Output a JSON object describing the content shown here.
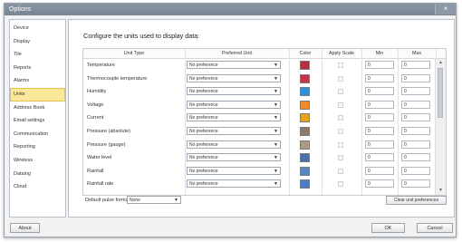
{
  "window": {
    "title": "Options",
    "close_glyph": "×"
  },
  "sidebar": {
    "items": [
      {
        "label": "Device"
      },
      {
        "label": "Display"
      },
      {
        "label": "Tile"
      },
      {
        "label": "Reports"
      },
      {
        "label": "Alarms"
      },
      {
        "label": "Units",
        "selected": true
      },
      {
        "label": "Address Book"
      },
      {
        "label": "Email settings"
      },
      {
        "label": "Communication"
      },
      {
        "label": "Reporting"
      },
      {
        "label": "Wireless"
      },
      {
        "label": "Datalog"
      },
      {
        "label": "Cloud"
      }
    ]
  },
  "main": {
    "heading": "Configure the units used to display data:",
    "columns": {
      "unit_type": "Unit Type",
      "preferred_unit": "Preferred Unit",
      "color": "Color",
      "apply_scale": "Apply Scale",
      "min": "Min",
      "max": "Max"
    },
    "rows": [
      {
        "unit_type": "Temperature",
        "preferred_unit": "No preference",
        "color": "#b8303f",
        "min": "0",
        "max": "0"
      },
      {
        "unit_type": "Thermocouple temperature",
        "preferred_unit": "No preference",
        "color": "#c8324a",
        "min": "0",
        "max": "0"
      },
      {
        "unit_type": "Humidity",
        "preferred_unit": "No preference",
        "color": "#2f8fd6",
        "min": "0",
        "max": "0"
      },
      {
        "unit_type": "Voltage",
        "preferred_unit": "No preference",
        "color": "#f08a2a",
        "min": "0",
        "max": "0"
      },
      {
        "unit_type": "Current",
        "preferred_unit": "No preference",
        "color": "#e6a51e",
        "min": "0",
        "max": "0"
      },
      {
        "unit_type": "Pressure (absolute)",
        "preferred_unit": "No preference",
        "color": "#8b7c6e",
        "min": "0",
        "max": "0"
      },
      {
        "unit_type": "Pressure (gauge)",
        "preferred_unit": "No preference",
        "color": "#a99a86",
        "min": "0",
        "max": "0"
      },
      {
        "unit_type": "Water level",
        "preferred_unit": "No preference",
        "color": "#4d6fa8",
        "min": "0",
        "max": "0"
      },
      {
        "unit_type": "Rainfall",
        "preferred_unit": "No preference",
        "color": "#5a86c0",
        "min": "0",
        "max": "0"
      },
      {
        "unit_type": "Rainfall rate",
        "preferred_unit": "No preference",
        "color": "#4a7bc4",
        "min": "0",
        "max": "0"
      }
    ],
    "default_pulse_label": "Default pulse format:",
    "default_pulse_value": "None",
    "clear_button": "Clear unit preferences"
  },
  "footer": {
    "about": "About",
    "ok": "OK",
    "cancel": "Cancel"
  },
  "colors": {
    "selected_bg": "#fbe79a",
    "titlebar": "#7f8a98"
  }
}
